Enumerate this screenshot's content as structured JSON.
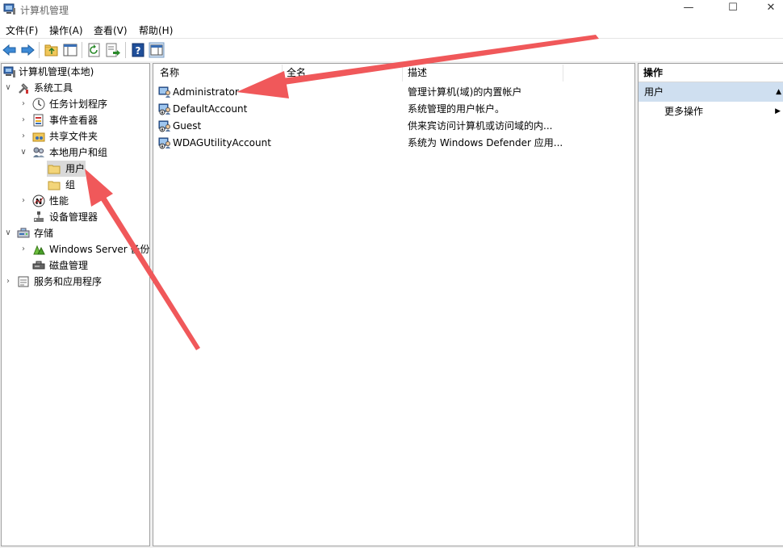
{
  "window": {
    "title": "计算机管理",
    "minimize": "—",
    "maximize": "☐",
    "close": "✕"
  },
  "menu": [
    "文件(F)",
    "操作(A)",
    "查看(V)",
    "帮助(H)"
  ],
  "tree": {
    "root": "计算机管理(本地)",
    "system_tools": "系统工具",
    "task_scheduler": "任务计划程序",
    "event_viewer": "事件查看器",
    "shared_folders": "共享文件夹",
    "local_users_groups": "本地用户和组",
    "users": "用户",
    "groups": "组",
    "performance": "性能",
    "device_manager": "设备管理器",
    "storage": "存储",
    "windows_server_backup": "Windows Server 备份",
    "disk_management": "磁盘管理",
    "services_apps": "服务和应用程序"
  },
  "list": {
    "columns": [
      "名称",
      "全名",
      "描述"
    ],
    "rows": [
      {
        "name": "Administrator",
        "fullname": "",
        "description": "管理计算机(域)的内置帐户"
      },
      {
        "name": "DefaultAccount",
        "fullname": "",
        "description": "系统管理的用户帐户。"
      },
      {
        "name": "Guest",
        "fullname": "",
        "description": "供来宾访问计算机或访问域的内..."
      },
      {
        "name": "WDAGUtilityAccount",
        "fullname": "",
        "description": "系统为 Windows Defender 应用..."
      }
    ]
  },
  "actions": {
    "header": "操作",
    "section": "用户",
    "more": "更多操作"
  },
  "colors": {
    "accent_selection": "#cfdff0",
    "annotation_arrow": "#f0585a"
  }
}
